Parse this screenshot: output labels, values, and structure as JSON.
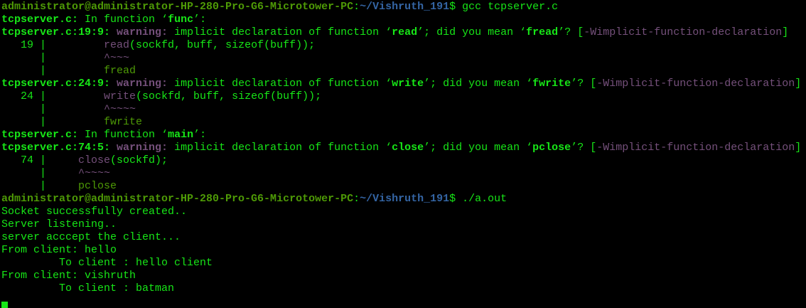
{
  "terminal": {
    "lines": [
      [
        {
          "t": "administrator@administrator-HP-280-Pro-G6-Microtower-PC",
          "c": "p"
        },
        {
          "t": ":",
          "c": "g"
        },
        {
          "t": "~/Vishruth_191",
          "c": "path"
        },
        {
          "t": "$ gcc tcpserver.c",
          "c": "g"
        }
      ],
      [
        {
          "t": "tcpserver.c:",
          "c": "gb"
        },
        {
          "t": " In function ‘",
          "c": "g"
        },
        {
          "t": "func",
          "c": "gb"
        },
        {
          "t": "’:",
          "c": "g"
        }
      ],
      [
        {
          "t": "tcpserver.c:19:9:",
          "c": "gb"
        },
        {
          "t": " ",
          "c": "g"
        },
        {
          "t": "warning:",
          "c": "w"
        },
        {
          "t": " implicit declaration of function ‘",
          "c": "g"
        },
        {
          "t": "read",
          "c": "gb"
        },
        {
          "t": "’; did you mean ‘",
          "c": "g"
        },
        {
          "t": "fread",
          "c": "gb"
        },
        {
          "t": "’? [",
          "c": "g"
        },
        {
          "t": "-Wimplicit-function-declaration",
          "c": "m"
        },
        {
          "t": "]",
          "c": "g"
        }
      ],
      [
        {
          "t": "   19 |         ",
          "c": "g"
        },
        {
          "t": "read",
          "c": "m"
        },
        {
          "t": "(sockfd, buff, sizeof(buff));",
          "c": "g"
        }
      ],
      [
        {
          "t": "      |         ",
          "c": "g"
        },
        {
          "t": "^~~~",
          "c": "m"
        }
      ],
      [
        {
          "t": "      |         ",
          "c": "g"
        },
        {
          "t": "fread",
          "c": "d"
        }
      ],
      [
        {
          "t": "tcpserver.c:24:9:",
          "c": "gb"
        },
        {
          "t": " ",
          "c": "g"
        },
        {
          "t": "warning:",
          "c": "w"
        },
        {
          "t": " implicit declaration of function ‘",
          "c": "g"
        },
        {
          "t": "write",
          "c": "gb"
        },
        {
          "t": "’; did you mean ‘",
          "c": "g"
        },
        {
          "t": "fwrite",
          "c": "gb"
        },
        {
          "t": "’? [",
          "c": "g"
        },
        {
          "t": "-Wimplicit-function-declaration",
          "c": "m"
        },
        {
          "t": "]",
          "c": "g"
        }
      ],
      [
        {
          "t": "   24 |         ",
          "c": "g"
        },
        {
          "t": "write",
          "c": "m"
        },
        {
          "t": "(sockfd, buff, sizeof(buff));",
          "c": "g"
        }
      ],
      [
        {
          "t": "      |         ",
          "c": "g"
        },
        {
          "t": "^~~~~",
          "c": "m"
        }
      ],
      [
        {
          "t": "      |         ",
          "c": "g"
        },
        {
          "t": "fwrite",
          "c": "d"
        }
      ],
      [
        {
          "t": "tcpserver.c:",
          "c": "gb"
        },
        {
          "t": " In function ‘",
          "c": "g"
        },
        {
          "t": "main",
          "c": "gb"
        },
        {
          "t": "’:",
          "c": "g"
        }
      ],
      [
        {
          "t": "tcpserver.c:74:5:",
          "c": "gb"
        },
        {
          "t": " ",
          "c": "g"
        },
        {
          "t": "warning:",
          "c": "w"
        },
        {
          "t": " implicit declaration of function ‘",
          "c": "g"
        },
        {
          "t": "close",
          "c": "gb"
        },
        {
          "t": "’; did you mean ‘",
          "c": "g"
        },
        {
          "t": "pclose",
          "c": "gb"
        },
        {
          "t": "’? [",
          "c": "g"
        },
        {
          "t": "-Wimplicit-function-declaration",
          "c": "m"
        },
        {
          "t": "]",
          "c": "g"
        }
      ],
      [
        {
          "t": "   74 |     ",
          "c": "g"
        },
        {
          "t": "close",
          "c": "m"
        },
        {
          "t": "(sockfd);",
          "c": "g"
        }
      ],
      [
        {
          "t": "      |     ",
          "c": "g"
        },
        {
          "t": "^~~~~",
          "c": "m"
        }
      ],
      [
        {
          "t": "      |     ",
          "c": "g"
        },
        {
          "t": "pclose",
          "c": "d"
        }
      ],
      [
        {
          "t": "administrator@administrator-HP-280-Pro-G6-Microtower-PC",
          "c": "p"
        },
        {
          "t": ":",
          "c": "g"
        },
        {
          "t": "~/Vishruth_191",
          "c": "path"
        },
        {
          "t": "$ ./a.out",
          "c": "g"
        }
      ],
      [
        {
          "t": "Socket successfully created..",
          "c": "g"
        }
      ],
      [
        {
          "t": "Server listening..",
          "c": "g"
        }
      ],
      [
        {
          "t": "server acccept the client...",
          "c": "g"
        }
      ],
      [
        {
          "t": "From client: hello",
          "c": "g"
        }
      ],
      [
        {
          "t": "         To client : hello client",
          "c": "g"
        }
      ],
      [
        {
          "t": "From client: vishruth",
          "c": "g"
        }
      ],
      [
        {
          "t": "         To client : batman",
          "c": "g"
        }
      ]
    ]
  }
}
